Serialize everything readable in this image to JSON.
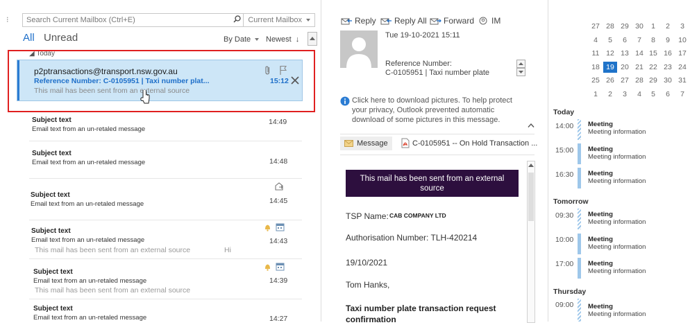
{
  "search": {
    "placeholder": "Search Current Mailbox (Ctrl+E)",
    "scope": "Current Mailbox"
  },
  "filters": {
    "all": "All",
    "unread": "Unread",
    "sort_by": "By Date",
    "order": "Newest"
  },
  "groups": {
    "today": "Today"
  },
  "selected_message": {
    "from": "p2ptransactions@transport.nsw.gov.au",
    "subject": "Reference Number: C-0105951 | Taxi number plat...",
    "time": "15:12",
    "preview": "This mail has been sent from an external source"
  },
  "messages": [
    {
      "subject": "Subject text",
      "text": "Email text from an un-retaled message",
      "time": "14:49"
    },
    {
      "subject": "Subject text",
      "text": "Email text from an un-retaled message",
      "time": "14:48"
    },
    {
      "subject": "Subject text",
      "text": "Email text from an un-retaled message",
      "time": "14:45"
    },
    {
      "subject": "Subject text",
      "text": "Email text from an un-retaled message",
      "time": "14:43",
      "preview": "This mail has been sent from an external source",
      "extra": "Hi"
    },
    {
      "subject": "Subject text",
      "text": "Email text from an un-retaled message",
      "time": "14:39",
      "preview": "This mail has been sent from an external source"
    },
    {
      "subject": "Subject text",
      "text": "Email text from an un-retaled message",
      "time": "14:27"
    }
  ],
  "reading": {
    "toolbar": {
      "reply": "Reply",
      "reply_all": "Reply All",
      "forward": "Forward",
      "im": "IM"
    },
    "date": "Tue 19-10-2021 15:11",
    "ref_label": "Reference Number:",
    "ref_value": "C-0105951 | Taxi number plate",
    "info": [
      "Click here to download pictures. To help protect",
      "your privacy, Outlook prevented automatic",
      "download of some pictures in this message."
    ],
    "attachments": {
      "message": "Message",
      "file": "C-0105951 -- On Hold Transaction ..."
    },
    "banner": [
      "This mail has been sent from an external",
      "source"
    ],
    "tsp_label": "TSP Name:",
    "tsp_value": "CAB COMPANY LTD",
    "auth": "Authorisation Number: TLH-420214",
    "date_line": "19/10/2021",
    "greeting": "Tom Hanks,",
    "title": "Taxi number plate transaction request confirmation"
  },
  "calendar": {
    "weeks": [
      [
        "27",
        "28",
        "29",
        "30",
        "1",
        "2",
        "3"
      ],
      [
        "4",
        "5",
        "6",
        "7",
        "8",
        "9",
        "10"
      ],
      [
        "11",
        "12",
        "13",
        "14",
        "15",
        "16",
        "17"
      ],
      [
        "18",
        "19",
        "20",
        "21",
        "22",
        "23",
        "24"
      ],
      [
        "25",
        "26",
        "27",
        "28",
        "29",
        "30",
        "31"
      ],
      [
        "1",
        "2",
        "3",
        "4",
        "5",
        "6",
        "7"
      ]
    ],
    "selected_day": "19"
  },
  "agenda": {
    "today": "Today",
    "tomorrow": "Tomorrow",
    "thursday": "Thursday",
    "events": [
      {
        "time": "14:00",
        "title": "Meeting",
        "info": "Meeting information"
      },
      {
        "time": "15:00",
        "title": "Meeting",
        "info": "Meeting information"
      },
      {
        "time": "16:30",
        "title": "Meeting",
        "info": "Meeting information"
      },
      {
        "time": "09:30",
        "title": "Meeting",
        "info": "Meeting information"
      },
      {
        "time": "10:00",
        "title": "Meeting",
        "info": "Meeting information"
      },
      {
        "time": "17:00",
        "title": "Meeting",
        "info": "Meeting information"
      },
      {
        "time": "09:00",
        "title": "Meeting",
        "info": "Meeting information"
      }
    ]
  },
  "colors": {
    "accent": "#1e6fc9",
    "selection": "#cde6f7",
    "highlight": "#e02020",
    "banner": "#2d0f3e"
  }
}
